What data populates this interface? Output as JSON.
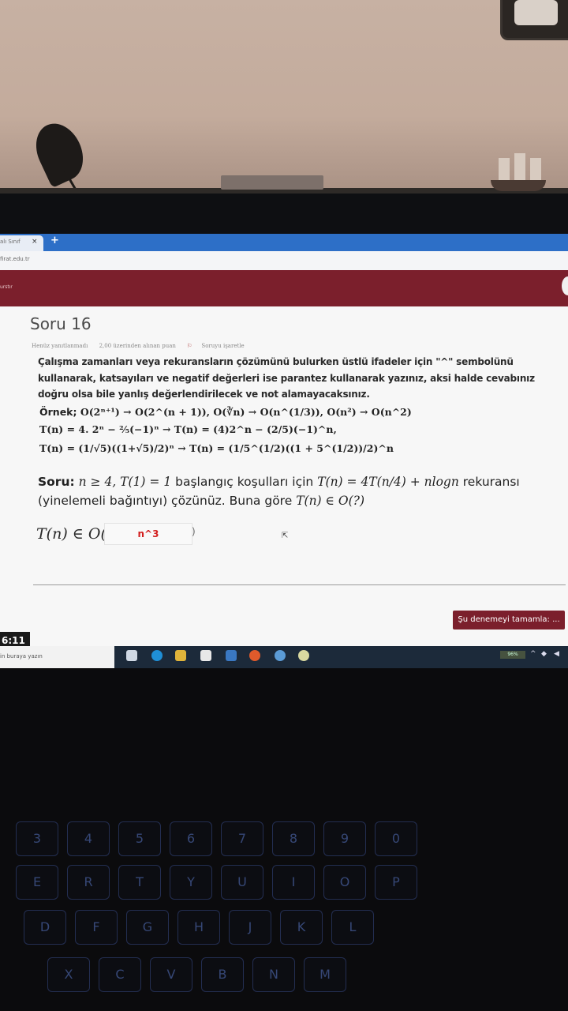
{
  "browser": {
    "tab_label": "alı Sınıf",
    "tab_close": "×",
    "new_tab": "+",
    "url": "firat.edu.tr",
    "site_menu": "urstır"
  },
  "question": {
    "title": "Soru 16",
    "status": "Henüz yanıtlanmadı",
    "points": "2,00 üzerinden alınan puan",
    "flag": "Soruyu işaretle",
    "instructions": "Çalışma zamanları veya rekuransların çözümünü bulurken üstlü ifadeler için \"^\" sembolünü kullanarak, katsayıları ve negatif değerleri ise parantez kullanarak yazınız, aksi halde cevabınız doğru olsa bile yanlış değerlendirilecek ve not alamayacaksınız.",
    "example_label": "Örnek;",
    "example_1": "O(2ⁿ⁺¹) → O(2^(n + 1)),  O(∛n) → O(n^(1/3)), O(n²) → O(n^2)",
    "example_2": "T(n) = 4. 2ⁿ − ⅖(−1)ⁿ → T(n) = (4)2^n − (2/5)(−1)^n,",
    "example_3": "T(n) = (1/√5)((1+√5)/2)ⁿ → T(n) = (1/5^(1/2)((1 + 5^(1/2))/2)^n",
    "soru_label": "Soru:",
    "soru_text_1": "n ≥ 4, T(1) = 1",
    "soru_text_2": "başlangıç koşulları için",
    "soru_text_3": "T(n) = 4T(n/4) + nlogn",
    "soru_text_4": "rekuransı",
    "soru_text_5": "(yinelemeli bağıntıyı) çözünüz. Buna göre",
    "soru_text_6": "T(n) ∈ O(?)",
    "answer_prefix": "T(n) ∈ O(",
    "answer_value": "n^3",
    "answer_suffix": ")"
  },
  "footer": {
    "finish_button": "Şu denemeyi tamamla: ...",
    "timer": "6:11"
  },
  "taskbar": {
    "search_placeholder": "in buraya yazın",
    "battery": "96%"
  },
  "keyboard": {
    "row1": [
      "3",
      "4",
      "5",
      "6",
      "7",
      "8",
      "9",
      "0"
    ],
    "row2": [
      "E",
      "R",
      "T",
      "Y",
      "U",
      "I",
      "O",
      "P"
    ],
    "row3": [
      "D",
      "F",
      "G",
      "H",
      "J",
      "K",
      "L"
    ],
    "row4": [
      "X",
      "C",
      "V",
      "B",
      "N",
      "M"
    ]
  }
}
